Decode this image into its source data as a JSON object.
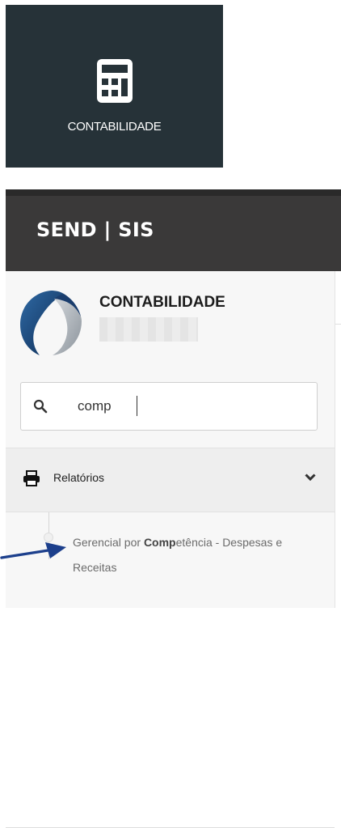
{
  "tile": {
    "label": "CONTABILIDADE",
    "icon": "calculator-icon"
  },
  "header": {
    "brand": "SEND | SIS"
  },
  "sidebar": {
    "company": {
      "name": "CONTABILIDADE",
      "icon": "company-logo"
    },
    "search": {
      "value": "comp",
      "icon": "search-icon"
    },
    "group": {
      "label": "Relatórios",
      "icon": "printer-icon",
      "expand_icon": "chevron-down-icon"
    },
    "item": {
      "label_prefix": "Gerencial por ",
      "label_match": "Comp",
      "label_suffix": "etência - Despesas e Receitas"
    }
  },
  "annotation": {
    "icon": "arrow-icon",
    "color": "#1c3f8c"
  },
  "colors": {
    "tile_bg": "#263238",
    "header_bg": "#3a3939",
    "sidebar_bg": "#f7f7f7"
  }
}
